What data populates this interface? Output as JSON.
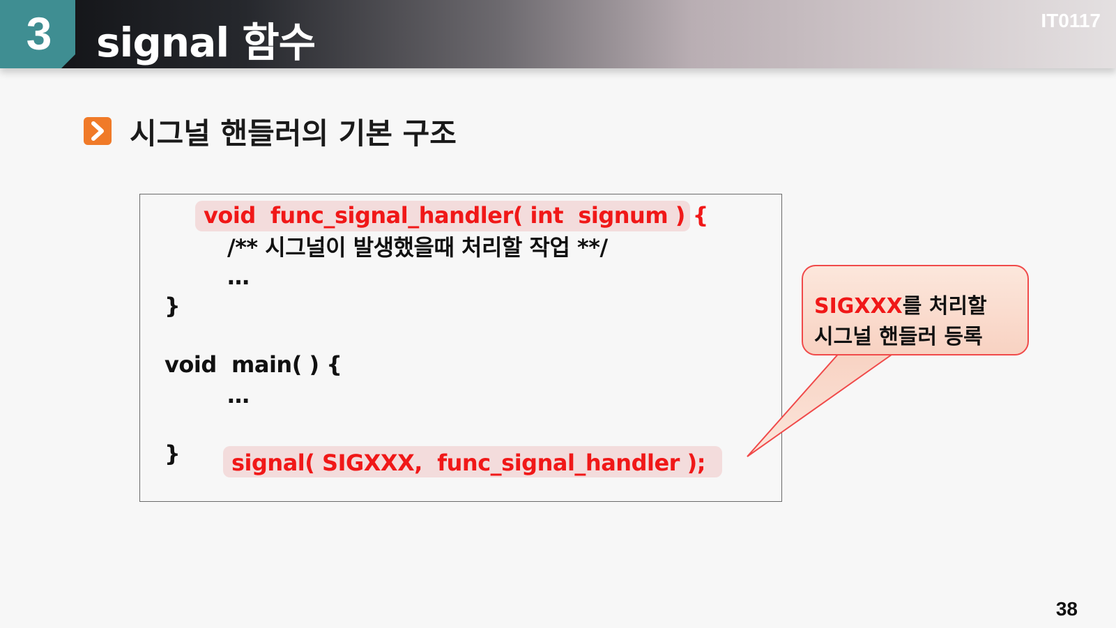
{
  "header": {
    "section_number": "3",
    "title": "signal 함수",
    "course_code": "IT0117"
  },
  "section": {
    "title": "시그널 핸들러의 기본 구조",
    "icon": "chevron-right-icon",
    "icon_color": "#f07a28"
  },
  "code": {
    "line1": "void  func_signal_handler( int  signum ) {",
    "line2": "/** 시그널이 발생했을때 처리할 작업 **/",
    "line3": "…",
    "line4": "}",
    "line5": "void  main( ) {",
    "line6": "…",
    "line7": "}",
    "line8": "signal( SIGXXX,  func_signal_handler );"
  },
  "callout": {
    "highlight": "SIGXXX",
    "line1_rest": "를 처리할",
    "line2": "시그널 핸들러 등록"
  },
  "colors": {
    "accent_teal": "#3f8e92",
    "code_red": "#f01818"
  },
  "page_number": "38"
}
